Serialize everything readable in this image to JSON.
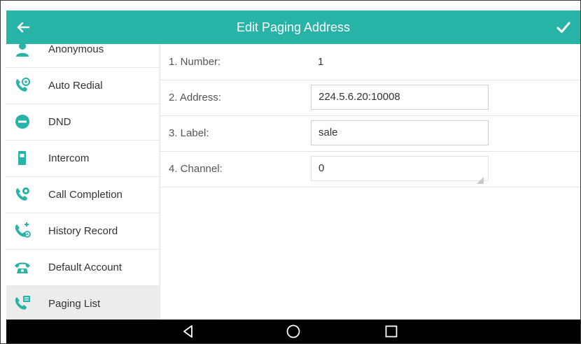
{
  "header": {
    "title": "Edit Paging Address",
    "back_icon": "arrow-left-icon",
    "confirm_icon": "checkmark-icon",
    "color": "#27b3a6"
  },
  "sidebar": {
    "items": [
      {
        "label": "Anonymous",
        "icon": "anonymous-person-icon",
        "active": false
      },
      {
        "label": "Auto Redial",
        "icon": "phone-redial-icon",
        "active": false
      },
      {
        "label": "DND",
        "icon": "do-not-disturb-icon",
        "active": false
      },
      {
        "label": "Intercom",
        "icon": "intercom-handset-icon",
        "active": false
      },
      {
        "label": "Call Completion",
        "icon": "call-completion-icon",
        "active": false
      },
      {
        "label": "History Record",
        "icon": "history-record-icon",
        "active": false
      },
      {
        "label": "Default Account",
        "icon": "telephone-icon",
        "active": false
      },
      {
        "label": "Paging List",
        "icon": "paging-list-icon",
        "active": true
      }
    ]
  },
  "form": {
    "number": {
      "label": "1. Number:",
      "value": "1"
    },
    "address": {
      "label": "2. Address:",
      "value": "224.5.6.20:10008"
    },
    "label": {
      "label": "3. Label:",
      "value": "sale"
    },
    "channel": {
      "label": "4. Channel:",
      "value": "0"
    }
  },
  "navbar": {
    "back_icon": "nav-back-triangle-icon",
    "home_icon": "nav-home-circle-icon",
    "recents_icon": "nav-recents-square-icon"
  }
}
